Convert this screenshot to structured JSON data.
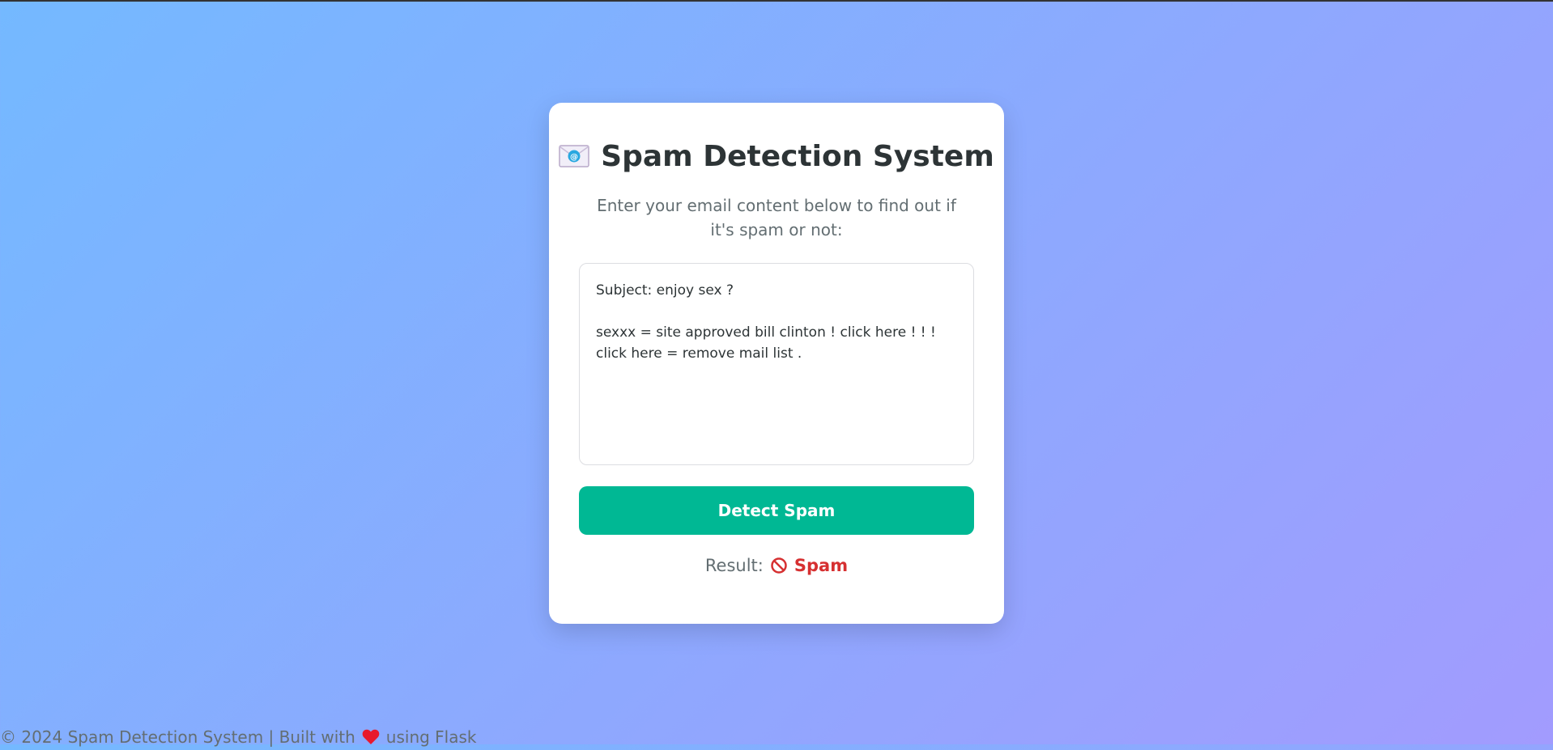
{
  "header": {
    "icon": "envelope-icon",
    "title": "Spam Detection System",
    "subtitle": "Enter your email content below to find out if it's spam or not:"
  },
  "form": {
    "email_content": "Subject: enjoy sex ?\n\nsexxx = site approved bill clinton ! click here ! ! !\nclick here = remove mail list .",
    "submit_label": "Detect Spam"
  },
  "result": {
    "label": "Result:",
    "icon": "prohibited-icon",
    "value": "Spam"
  },
  "footer": {
    "text_before": "© 2024 Spam Detection System | Built with",
    "icon": "heart-icon",
    "text_after": "using Flask"
  },
  "colors": {
    "accent": "#00b894",
    "spam": "#d63031",
    "background_start": "#74b9ff",
    "background_end": "#a29bfe"
  }
}
